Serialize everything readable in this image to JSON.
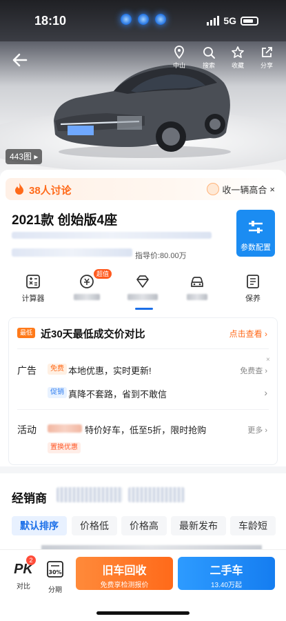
{
  "status_bar": {
    "time": "18:10",
    "network": "5G"
  },
  "nav": {
    "location_label": "中山",
    "search_label": "搜索",
    "favorite_label": "收藏",
    "share_label": "分享"
  },
  "gallery": {
    "count_label": "443图 ▸"
  },
  "discussion": {
    "count_label": "38人讨论",
    "chevron": "›",
    "collect_label": "收一辆高合",
    "collect_close": "×"
  },
  "model": {
    "title": "2021款 创始版4座",
    "price_guide": "指导价:80.00万",
    "params_label": "参数配置"
  },
  "tools": {
    "calculator": "计算器",
    "super_tag": "超值",
    "maintenance": "保养"
  },
  "deals": {
    "low_badge": "最低",
    "low_title": "近30天最低成交价对比",
    "low_link": "点击查看 ›",
    "ad_label": "广告",
    "ad_pill": "免费",
    "ad_text": "本地优惠，实时更新!",
    "ad_right": "免费查 ›",
    "promo_pill": "促销",
    "promo_text": "真降不套路，省到不敢信",
    "promo_right": "›",
    "activity_label": "活动",
    "activity_text": "特价好车，低至5折，限时抢购",
    "activity_right": "更多 ›",
    "exchange_pill": "置换优惠",
    "close": "×"
  },
  "dealer": {
    "title": "经销商",
    "sort_tabs": [
      "默认排序",
      "价格低",
      "价格高",
      "最新发布",
      "车龄短"
    ]
  },
  "bottom_bar": {
    "pk_label": "PK",
    "pk_badge": "2",
    "compare_label": "对比",
    "installment_icon_text": "30%",
    "installment_label": "分期",
    "trade_in_main": "旧车回收",
    "trade_in_sub": "免费享检测报价",
    "used_car_main": "二手车",
    "used_car_sub": "13.40万起"
  },
  "colors": {
    "accent_orange": "#ff6a1a",
    "accent_blue": "#1b8cf2",
    "active_tab": "#1b6fe8"
  }
}
